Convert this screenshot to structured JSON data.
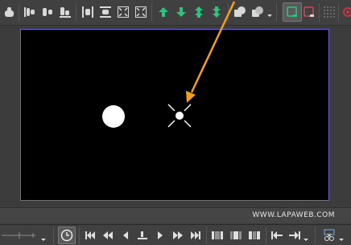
{
  "watermark": "WWW.LAPAWEB.COM",
  "colors": {
    "stage_border": "#6a63c9",
    "arrow": "#f0a020",
    "green_icon": "#2ec27e",
    "stage_bg": "#000000"
  },
  "top_toolbar": {
    "icons": [
      "align-left-icon",
      "align-top-icon",
      "align-center-icon",
      "align-bottom-icon",
      "distribute-horizontal-icon",
      "distribute-vertical-icon",
      "fit-to-stage-icon",
      "scale-to-fit-icon",
      "move-up-icon",
      "move-down-icon",
      "move-to-top-icon",
      "move-to-bottom-icon",
      "shape-union-icon",
      "shape-subtract-icon",
      "snap-to-objects-icon",
      "snap-to-grid-icon",
      "grid-icon",
      "onion-skin-icon"
    ]
  },
  "bottom_toolbar": {
    "icons": [
      "zoom-slider",
      "clock-icon",
      "first-frame-icon",
      "previous-keyframe-icon",
      "previous-frame-icon",
      "stop-icon",
      "play-icon",
      "next-frame-icon",
      "next-keyframe-icon",
      "last-frame-icon",
      "frame-mode-a-icon",
      "frame-mode-b-icon",
      "frame-mode-c-icon",
      "prev-marker-icon",
      "next-marker-icon",
      "scissors-icon"
    ]
  }
}
